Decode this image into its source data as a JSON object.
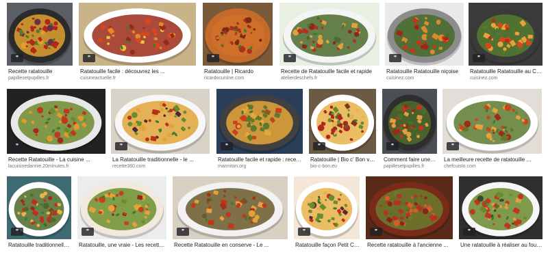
{
  "badge_glyph": "❞",
  "results": [
    {
      "title": "Recette ratatouille",
      "source": "papillesetpupilles.fr",
      "bg": "#5a5f66",
      "dish": "#2b2b2b",
      "food": [
        "#b3261e",
        "#5c7a2e",
        "#e0a030",
        "#6b2f4a"
      ]
    },
    {
      "title": "Ratatouille facile : découvrez les ...",
      "source": "cuisineactuelle.fr",
      "bg": "#c9b48a",
      "dish": "#ffffff",
      "food": [
        "#d9451e",
        "#e58a2a",
        "#9a2a18",
        "#f0c040"
      ]
    },
    {
      "title": "Ratatouille | Ricardo",
      "source": "ricardocuisine.com",
      "bg": "#7b5a3a",
      "dish": "#c46a2a",
      "food": [
        "#a8321c",
        "#7a2a14",
        "#d0702a",
        "#5a6a2a"
      ]
    },
    {
      "title": "Recette de Ratatouille facile et rapide",
      "source": "atelierdeschefs.fr",
      "bg": "#e8f0e4",
      "dish": "#f4f4f4",
      "food": [
        "#b3301e",
        "#e0a040",
        "#4a6a2a",
        "#8a2a1a"
      ]
    },
    {
      "title": "Ratatouille Ratatouille niçoise",
      "source": "cuisinez.com",
      "bg": "#e9e9e9",
      "dish": "#8c8c8c",
      "food": [
        "#c0371e",
        "#dd8b2a",
        "#476b2a",
        "#a2251a"
      ]
    },
    {
      "title": "Ratatouille Ratatouille au Cookeo",
      "source": "cuisinez.com",
      "bg": "#3c3c3c",
      "dish": "#3a3a3a",
      "food": [
        "#d14a1e",
        "#e9a23a",
        "#557b2e",
        "#b82c1a"
      ]
    },
    {
      "title": "Recette Ratatouille - La cuisine ...",
      "source": "lacuisinedannie.20minutes.fr",
      "bg": "#222222",
      "dish": "#e8e8e8",
      "food": [
        "#c2361c",
        "#e39a2c",
        "#6d8a2e",
        "#a32a18"
      ]
    },
    {
      "title": "La Ratatouille traditionnelle - le ...",
      "source": "recette360.com",
      "bg": "#d9d2c6",
      "dish": "#f7f7f7",
      "food": [
        "#b8301e",
        "#6a8a2e",
        "#e0a43a",
        "#4a2a3a"
      ]
    },
    {
      "title": "Ratatouille facile et rapide : recette ...",
      "source": "marmiton.org",
      "bg": "#2a3e5a",
      "dish": "#404040",
      "food": [
        "#c8401e",
        "#5c7a2e",
        "#e5a63a",
        "#6b2f4a"
      ]
    },
    {
      "title": "Ratatouille | Bio c' Bon votre ...",
      "source": "bio-c-bon.eu",
      "bg": "#6b5a44",
      "dish": "#ffffff",
      "food": [
        "#b3261e",
        "#6a8a2e",
        "#e7b24a",
        "#7b3a20"
      ]
    },
    {
      "title": "Comment faire une rat...",
      "source": "papillesetpupilles.fr",
      "bg": "#4b4f55",
      "dish": "#2e2e2e",
      "food": [
        "#c0371e",
        "#e0a040",
        "#4d6b2a",
        "#9a2a18"
      ]
    },
    {
      "title": "La meilleure recette de ratatouille ...",
      "source": "chefcuisto.com",
      "bg": "#e2ddd6",
      "dish": "#ffffff",
      "food": [
        "#c8461e",
        "#e8a23a",
        "#5c7a2e",
        "#a02a18"
      ]
    },
    {
      "title": "Ratatouille traditionnelle : dé...",
      "source": "",
      "bg": "#3e6a72",
      "dish": "#ffffff",
      "food": [
        "#c0301c",
        "#e9b34a",
        "#4b6a2a",
        "#a02a18"
      ]
    },
    {
      "title": "Ratatouille, une vraie - Les recettes ...",
      "source": "",
      "bg": "#ececec",
      "dish": "#f1e9dc",
      "food": [
        "#c7401c",
        "#e6a23a",
        "#6c8f2e",
        "#9a2a18"
      ]
    },
    {
      "title": "Recette Ratatouille en conserve - Le ...",
      "source": "",
      "bg": "#d8d0c2",
      "dish": "#f2f2f2",
      "food": [
        "#c0371e",
        "#e5a23a",
        "#6a5a2a",
        "#a33018"
      ]
    },
    {
      "title": "Ratatouille façon Petit Chef : ...",
      "source": "",
      "bg": "#f4e6d8",
      "dish": "#ffffff",
      "food": [
        "#c8301e",
        "#6d8a2e",
        "#e7b24a",
        "#5a2a3a"
      ]
    },
    {
      "title": "Recette ratatouille à l'ancienne ...",
      "source": "",
      "bg": "#5a2a18",
      "dish": "#7a2a18",
      "food": [
        "#b8301e",
        "#d0602a",
        "#6a7a2e",
        "#8a2418"
      ]
    },
    {
      "title": "Une ratatouille à réaliser au four - La ...",
      "source": "",
      "bg": "#2f2f2f",
      "dish": "#f7f7f7",
      "food": [
        "#c0371e",
        "#e0a040",
        "#6a8a2e",
        "#3a4a2a"
      ]
    }
  ]
}
